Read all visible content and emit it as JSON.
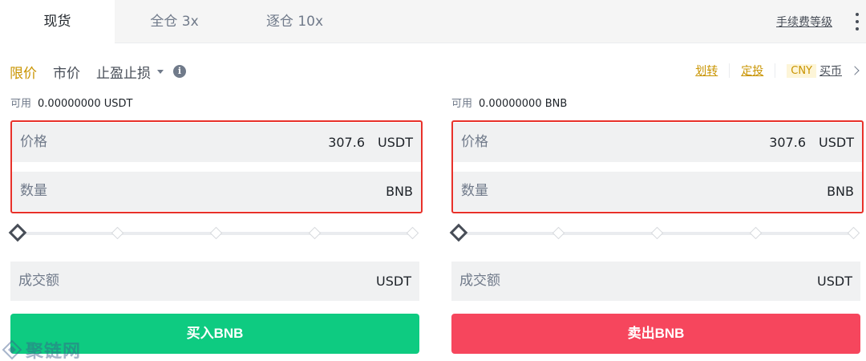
{
  "tabs": [
    {
      "label": "现货",
      "active": true
    },
    {
      "label": "全仓 3x",
      "active": false
    },
    {
      "label": "逐仓 10x",
      "active": false
    }
  ],
  "header": {
    "fee_level": "手续费等级"
  },
  "order_types": {
    "limit": "限价",
    "market": "市价",
    "stop": "止盈止损",
    "active": "limit"
  },
  "links": {
    "transfer": "划转",
    "auto_invest": "定投",
    "currency": "CNY",
    "buy_crypto": "买币"
  },
  "buy": {
    "available_label": "可用",
    "available_value": "0.00000000 USDT",
    "price_label": "价格",
    "price_value": "307.6",
    "price_unit": "USDT",
    "qty_label": "数量",
    "qty_unit": "BNB",
    "total_label": "成交额",
    "total_unit": "USDT",
    "button": "买入BNB",
    "slider_percent": 0
  },
  "sell": {
    "available_label": "可用",
    "available_value": "0.00000000 BNB",
    "price_label": "价格",
    "price_value": "307.6",
    "price_unit": "USDT",
    "qty_label": "数量",
    "qty_unit": "BNB",
    "total_label": "成交额",
    "total_unit": "USDT",
    "button": "卖出BNB",
    "slider_percent": 0
  },
  "colors": {
    "accent": "#c99400",
    "buy": "#0ecb81",
    "sell": "#f6465d",
    "highlight_border": "#e8312a"
  },
  "watermark": "聚链网"
}
